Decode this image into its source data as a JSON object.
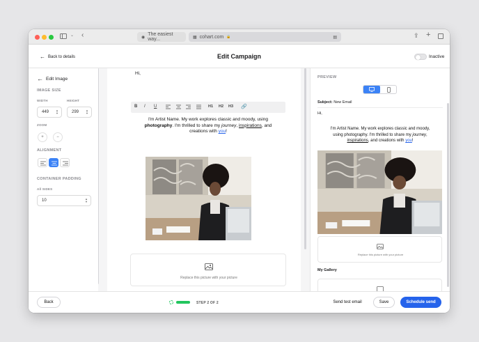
{
  "browser": {
    "tabs": [
      {
        "title": "The easiest way..."
      },
      {
        "title": "cohart.com"
      }
    ]
  },
  "header": {
    "back_label": "Back to details",
    "title": "Edit Campaign",
    "status_label": "Inactive"
  },
  "sidebar": {
    "title": "Edit Image",
    "image_size_label": "IMAGE SIZE",
    "width_label": "WIDTH",
    "width_value": "449",
    "height_label": "HEIGHT",
    "height_value": "299",
    "zoom_label": "ZOOM",
    "alignment_label": "ALIGNMENT",
    "alignment_selected": "center",
    "padding_label": "CONTAINER PADDING",
    "all_sides_label": "All SIDES",
    "all_sides_value": "10"
  },
  "editor": {
    "greeting": "Hi,",
    "toolbar": [
      "B",
      "I",
      "U",
      "H1",
      "H2",
      "H3"
    ],
    "body": {
      "line1": "I'm Artist Name. My work explores classic and moody, using",
      "bold_word": "photography",
      "line2_mid": ". I'm thrilled to share my ",
      "journey": "journey",
      "comma": ", ",
      "inspirations": "inspirations",
      "and": ", and",
      "line3": "creations with ",
      "you": "you",
      "bang": "!"
    },
    "replace_text": "Replace this picture with your picture"
  },
  "preview": {
    "label": "PREVIEW",
    "subject_label": "Subject:",
    "subject_value": "New Email",
    "greeting": "Hi,",
    "body": {
      "line1": "I'm Artist Name. My work explores classic and moody,",
      "line2a": "using photography. I'm thrilled to share my ",
      "journey": "journey",
      "comma": ",",
      "inspirations": "inspirations",
      "and": ", and creations with ",
      "you": "you",
      "bang": "!"
    },
    "replace_text": "Replace this picture with your picture",
    "gallery_title": "My Gallery"
  },
  "footer": {
    "back": "Back",
    "step": "STEP 2 OF 2",
    "progress": 1.0,
    "test": "Send test email",
    "save": "Save",
    "schedule": "Schedule send"
  },
  "colors": {
    "accent": "#2563eb",
    "progress": "#22c55e"
  }
}
